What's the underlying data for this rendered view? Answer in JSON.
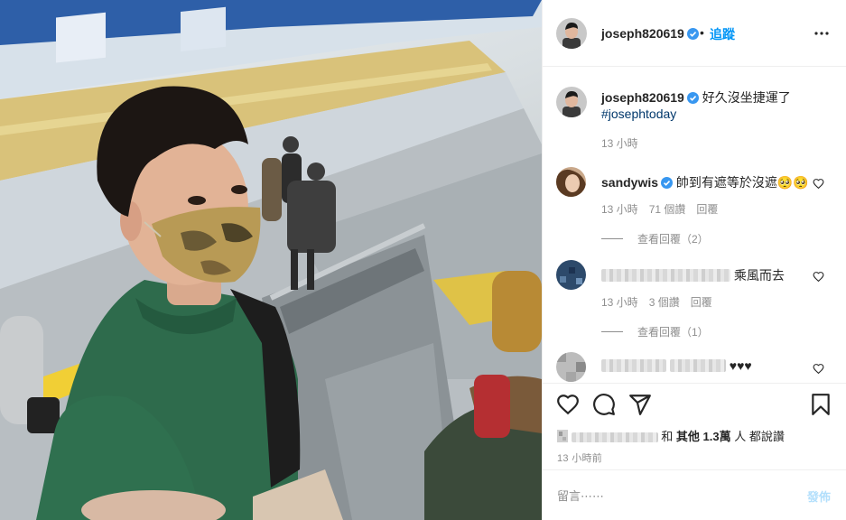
{
  "post": {
    "author": "joseph820619",
    "follow_separator": "•",
    "follow_label": "追蹤",
    "caption_text": "好久沒坐捷運了",
    "hashtag": "#josephtoday",
    "caption_time": "13 小時",
    "more_icon": "more-horizontal-icon"
  },
  "comments": [
    {
      "username": "sandywis",
      "verified": true,
      "text": "帥到有遮等於沒遮🥺🥺",
      "time": "13 小時",
      "likes": "71 個讚",
      "reply_label": "回覆",
      "view_replies": "查看回覆（2）"
    },
    {
      "username": "",
      "verified": false,
      "text": "乘風而去",
      "time": "13 小時",
      "likes": "3 個讚",
      "reply_label": "回覆",
      "view_replies": "查看回覆（1）"
    },
    {
      "username": "",
      "verified": false,
      "text": "♥♥♥"
    }
  ],
  "actions": {
    "like_icon": "heart-icon",
    "comment_icon": "comment-icon",
    "share_icon": "share-icon",
    "save_icon": "bookmark-icon"
  },
  "likes_summary": {
    "connector": "和",
    "others_prefix": "其他",
    "count": "1.3萬",
    "suffix": "人 都說讚"
  },
  "posted_time": "13 小時前",
  "composer": {
    "placeholder": "留言⋯⋯",
    "post_label": "發佈"
  },
  "colors": {
    "accent": "#0095f6",
    "post_disabled": "#b2dffc",
    "muted_text": "#8e8e8e",
    "hashtag": "#00376b",
    "verified_badge": "#3897f0"
  }
}
